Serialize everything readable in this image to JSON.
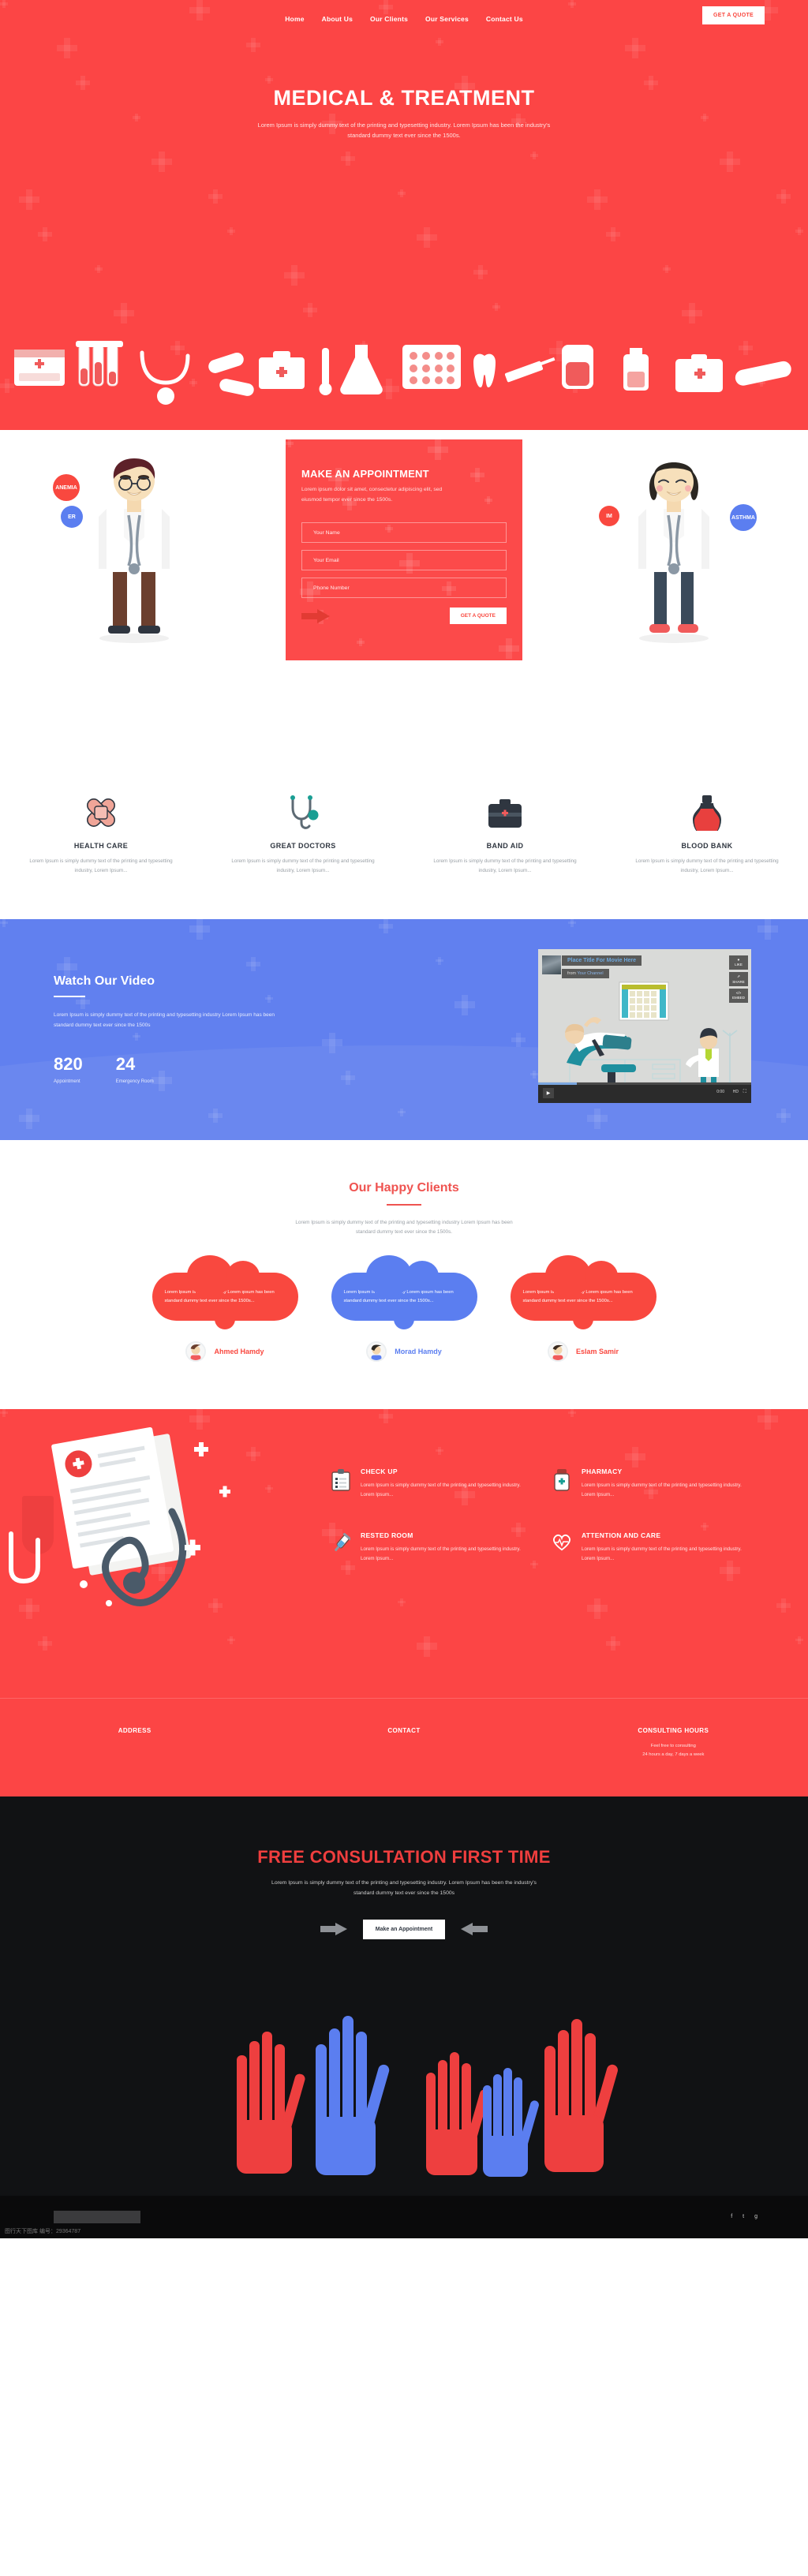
{
  "brand": {
    "accent_red": "#fc4545",
    "accent_blue": "#6180ef",
    "dark": "#111214",
    "teal": "#1a9e93"
  },
  "nav": {
    "items": [
      {
        "label": "Home"
      },
      {
        "label": "About Us"
      },
      {
        "label": "Our Clients"
      },
      {
        "label": "Our Services"
      },
      {
        "label": "Contact Us"
      }
    ],
    "quote_button": "GET A QUOTE"
  },
  "hero": {
    "title": "MEDICAL & TREATMENT",
    "subtitle_line1": "Lorem Ipsum is simply dummy text of the printing and typesetting industry. Lorem Ipsum has been the industry's",
    "subtitle_line2": "standard dummy text ever since the 1500s."
  },
  "appointment": {
    "badges": [
      {
        "label": "ANEMIA",
        "color": "#f9483f"
      },
      {
        "label": "ER",
        "color": "#5b7ef0"
      },
      {
        "label": "IM",
        "color": "#f9483f"
      },
      {
        "label": "ASTHMA",
        "color": "#5b7ef0"
      }
    ],
    "title": "MAKE AN APPOINTMENT",
    "lead_line1": "Lorem ipsum dolor sit amet, consectetur adipiscing elit, sed",
    "lead_line2": "eiusmod tempor ever since the 1500s.",
    "fields": [
      {
        "name": "name",
        "placeholder": "Your Name",
        "value": ""
      },
      {
        "name": "email",
        "placeholder": "Your Email",
        "value": ""
      },
      {
        "name": "phone",
        "placeholder": "Phone Number",
        "value": ""
      }
    ],
    "submit_label": "GET A QUOTE"
  },
  "features": [
    {
      "icon": "bandaid-icon",
      "title": "HEALTH CARE",
      "desc": "Lorem Ipsum is simply dummy text of the printing and typesetting industry, Lorem Ipsum..."
    },
    {
      "icon": "stethoscope-icon",
      "title": "GREAT DOCTORS",
      "desc": "Lorem Ipsum is simply dummy text of the printing and typesetting industry, Lorem Ipsum..."
    },
    {
      "icon": "medical-bag-icon",
      "title": "BAND AID",
      "desc": "Lorem Ipsum is simply dummy text of the printing and typesetting industry, Lorem Ipsum..."
    },
    {
      "icon": "blood-flask-icon",
      "title": "BLOOD BANK",
      "desc": "Lorem Ipsum is simply dummy text of the printing and typesetting industry, Lorem Ipsum..."
    }
  ],
  "video": {
    "heading": "Watch Our Video",
    "desc": "Lorem Ipsum is simply dummy text of the printing and typesetting industry Lorem Ipsum has been standard dummy text ever since the 1500s",
    "stats": [
      {
        "number": "820",
        "label": "Appointment"
      },
      {
        "number": "24",
        "label": "Emergency Room"
      }
    ],
    "player": {
      "title": "Place Title For Movie Here",
      "channel_prefix": "from",
      "channel": "Your Channel",
      "side_buttons": [
        {
          "icon": "heart-icon",
          "label": "LIKE"
        },
        {
          "icon": "share-icon",
          "label": "SHARE"
        },
        {
          "icon": "embed-icon",
          "label": "EMBED"
        }
      ],
      "play_icon": "play-icon",
      "timestamp": "0:00",
      "quality": "HD",
      "fullscreen_icon": "fullscreen-icon"
    }
  },
  "clients": {
    "heading": "Our Happy Clients",
    "intro_line1": "Lorem Ipsum is simply dummy text of the printing and typesetting industry Lorem Ipsum has been",
    "intro_line2": "standard dummy text ever since the 1500s.",
    "items": [
      {
        "quote": "Lorem Ipsum is simply dummy Lorem Ipsum has been standard dummy text ever since the 1500s...",
        "name": "Ahmed Hamdy",
        "color": "#f9483f"
      },
      {
        "quote": "Lorem Ipsum is simply dummy Lorem Ipsum has been standard dummy text ever since the 1500s...",
        "name": "Morad Hamdy",
        "color": "#5b7ef0"
      },
      {
        "quote": "Lorem Ipsum is simply dummy Lorem Ipsum has been standard dummy text ever since the 1500s...",
        "name": "Eslam Samir",
        "color": "#f9483f"
      }
    ]
  },
  "red_services": [
    {
      "icon": "clipboard-icon",
      "title": "CHECK UP",
      "desc": "Lorem Ipsum is simply dummy text of the printing and typesetting industry. Lorem Ipsum..."
    },
    {
      "icon": "pill-bottle-icon",
      "title": "PHARMACY",
      "desc": "Lorem Ipsum is simply dummy text of the printing and typesetting industry. Lorem Ipsum..."
    },
    {
      "icon": "syringe-icon",
      "title": "RESTED ROOM",
      "desc": "Lorem Ipsum is simply dummy text of the printing and typesetting industry. Lorem Ipsum..."
    },
    {
      "icon": "heart-care-icon",
      "title": "ATTENTION AND CARE",
      "desc": "Lorem Ipsum is simply dummy text of the printing and typesetting industry. Lorem Ipsum..."
    }
  ],
  "footer_red": {
    "columns": [
      {
        "title": "ADDRESS",
        "line1": "",
        "line2": ""
      },
      {
        "title": "CONTACT",
        "line1": "",
        "line2": ""
      },
      {
        "title": "CONSULTING HOURS",
        "line1": "Feel free to consulting",
        "line2": "24 hours a day, 7 days a week"
      }
    ]
  },
  "dark_cta": {
    "heading": "FREE CONSULTATION FIRST TIME",
    "line1": "Lorem Ipsum is simply dummy text of the printing and typesetting industry. Lorem Ipsum has been the industry's",
    "line2": "standard dummy text ever since the 1500s",
    "button": "Make an Appointment",
    "socials": [
      {
        "icon": "facebook-icon",
        "glyph": "f"
      },
      {
        "icon": "twitter-icon",
        "glyph": "t"
      },
      {
        "icon": "google-plus-icon",
        "glyph": "g"
      }
    ]
  },
  "watermark": "图行天下图库 编号：29364787"
}
